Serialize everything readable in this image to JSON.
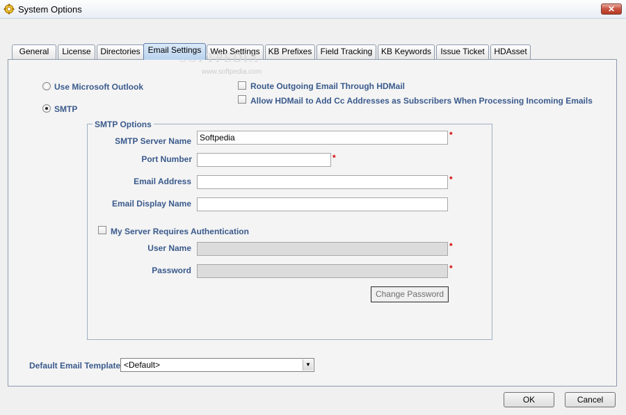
{
  "window": {
    "title": "System Options",
    "close_glyph": "✕",
    "icon": "gear-app-icon"
  },
  "tabs": [
    {
      "label": "General"
    },
    {
      "label": "License"
    },
    {
      "label": "Directories"
    },
    {
      "label": "Email Settings",
      "active": true
    },
    {
      "label": "Web Settings"
    },
    {
      "label": "KB Prefixes"
    },
    {
      "label": "Field Tracking"
    },
    {
      "label": "KB Keywords"
    },
    {
      "label": "Issue Ticket"
    },
    {
      "label": "HDAsset"
    }
  ],
  "watermark": {
    "main": "SOFTPEDIA",
    "sub": "www.softpedia.com"
  },
  "mail_source": {
    "outlook_label": "Use Microsoft Outlook",
    "outlook_selected": false,
    "smtp_label": "SMTP",
    "smtp_selected": true
  },
  "options": {
    "route_label": "Route Outgoing Email Through HDMail",
    "route_checked": false,
    "cc_label": "Allow HDMail to Add Cc Addresses as Subscribers When Processing Incoming Emails",
    "cc_checked": false
  },
  "smtp": {
    "group_title": "SMTP Options",
    "server_name_label": "SMTP Server Name",
    "server_name_value": "Softpedia",
    "port_label": "Port Number",
    "port_value": "",
    "email_label": "Email Address",
    "email_value": "",
    "display_name_label": "Email Display Name",
    "display_name_value": "",
    "auth_label": "My Server Requires Authentication",
    "auth_checked": false,
    "username_label": "User Name",
    "username_value": "",
    "password_label": "Password",
    "password_value": "",
    "change_password_label": "Change Password",
    "required_mark": "*"
  },
  "template": {
    "label": "Default Email Template",
    "selected": "<Default>",
    "arrow_glyph": "▼"
  },
  "footer": {
    "ok_label": "OK",
    "cancel_label": "Cancel"
  },
  "colors": {
    "label_blue": "#3a5a8c",
    "required_red": "#d40000",
    "active_tab": "#b9d3ee"
  }
}
